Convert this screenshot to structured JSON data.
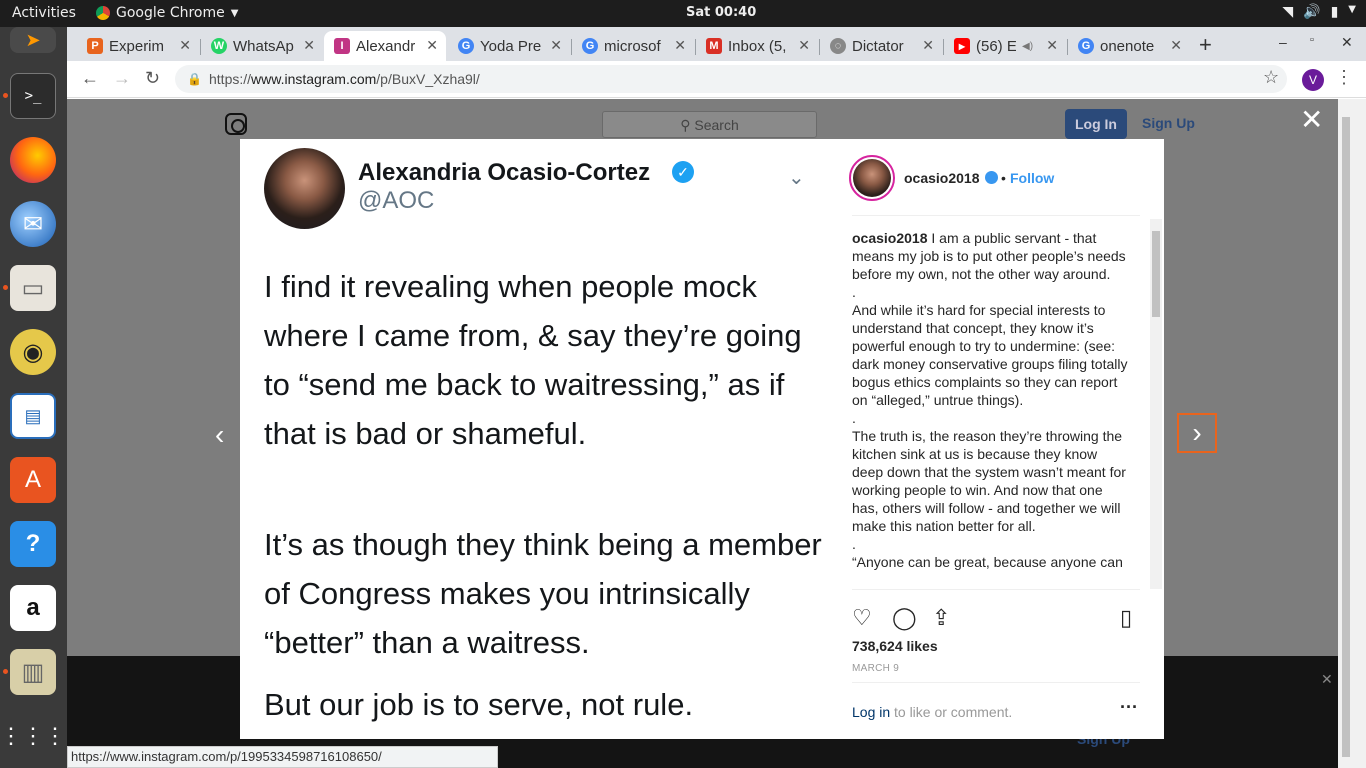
{
  "topbar": {
    "activities": "Activities",
    "app_name": "Google Chrome",
    "clock": "Sat 00:40"
  },
  "dock": {
    "items": [
      "sublime-text",
      "terminal",
      "firefox",
      "thunderbird",
      "files",
      "rhythmbox",
      "writer",
      "software",
      "help",
      "amazon",
      "archive",
      "app-grid"
    ]
  },
  "tabs": [
    {
      "title": "Experim",
      "fav": "P",
      "color": "#e8641e"
    },
    {
      "title": "WhatsAp",
      "fav": "W",
      "color": "#25d366"
    },
    {
      "title": "Alexandr",
      "fav": "I",
      "color": "#c13584"
    },
    {
      "title": "Yoda Pre",
      "fav": "G",
      "color": "#4285f4"
    },
    {
      "title": "microsof",
      "fav": "G",
      "color": "#4285f4"
    },
    {
      "title": "Inbox (5,",
      "fav": "M",
      "color": "#d93025"
    },
    {
      "title": "Dictator",
      "fav": "D",
      "color": "#888888"
    },
    {
      "title": "(56) E",
      "fav": "▶",
      "color": "#ff0000"
    },
    {
      "title": "onenote",
      "fav": "G",
      "color": "#4285f4"
    }
  ],
  "omnibox": {
    "scheme": "https://",
    "host": "www.instagram.com",
    "path": "/p/BuxV_Xzha9l/"
  },
  "profile_initial": "V",
  "ig": {
    "search_placeholder": "Search",
    "login": "Log In",
    "signup": "Sign Up",
    "bg_signup": "Sign Up"
  },
  "tweet": {
    "name": "Alexandria Ocasio-Cortez",
    "handle": "@AOC",
    "paragraphs": [
      "I find it revealing when people mock where I came from, & say they’re going to “send me back to waitressing,” as if that is bad or shameful.",
      "It’s as though they think being a member of Congress makes you intrinsically “better” than a waitress.",
      "But our job is to serve, not rule."
    ]
  },
  "post": {
    "username": "ocasio2018",
    "follow_sep": "•",
    "follow": "Follow",
    "caption_user": "ocasio2018",
    "caption_lines": [
      " I am a public servant - that means my job is to put other people’s needs before my own, not the other way around.",
      ".",
      "And while it’s hard for special interests to understand that concept, they know it’s powerful enough to try to undermine: (see: dark money conservative groups filing totally bogus ethics complaints so they can report on “alleged,” untrue things).",
      ".",
      "The truth is, the reason they’re throwing the kitchen sink at us is because they know deep down that the system wasn’t meant for working people to win. And now that one has, others will follow - and together we will make this nation better for all.",
      ".",
      "“Anyone can be great, because anyone can"
    ],
    "likes": "738,624 likes",
    "date": "MARCH 9",
    "login_link": "Log in",
    "login_rest": "to like or comment."
  },
  "status_url": "https://www.instagram.com/p/1995334598716108650/"
}
